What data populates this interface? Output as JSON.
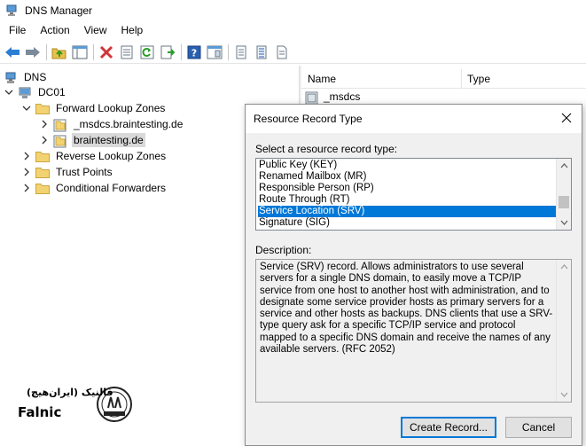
{
  "window": {
    "title": "DNS Manager"
  },
  "menu": [
    "File",
    "Action",
    "View",
    "Help"
  ],
  "toolbar_icons": [
    "back-arrow-icon",
    "forward-arrow-icon",
    "folder-up-icon",
    "show-hide-tree-icon",
    "delete-icon",
    "properties-icon",
    "refresh-icon",
    "export-list-icon",
    "help-icon",
    "console-icon",
    "list-icon",
    "detail-list-icon",
    "document-icon"
  ],
  "tree": {
    "root": "DNS",
    "server": "DC01",
    "forward": "Forward Lookup Zones",
    "zone1": "_msdcs.braintesting.de",
    "zone2": "braintesting.de",
    "reverse": "Reverse Lookup Zones",
    "trust": "Trust Points",
    "conditional": "Conditional Forwarders"
  },
  "list": {
    "col_name": "Name",
    "col_type": "Type",
    "row1": "_msdcs"
  },
  "dialog": {
    "title": "Resource Record Type",
    "select_label": "Select a resource record type:",
    "items": [
      "Public Key (KEY)",
      "Renamed Mailbox (MR)",
      "Responsible Person (RP)",
      "Route Through (RT)",
      "Service Location (SRV)",
      "Signature (SIG)"
    ],
    "selected_index": 4,
    "description_label": "Description:",
    "description": "Service (SRV) record. Allows administrators to use several servers for a single DNS domain, to easily move a TCP/IP service from one host to another host with administration, and to designate some service provider hosts as primary servers for a service and other hosts as backups. DNS clients that use a SRV-type query ask for a specific TCP/IP service and protocol mapped to a specific DNS domain and receive the names of any available servers. (RFC 2052)",
    "create_button": "Create Record...",
    "cancel_button": "Cancel"
  },
  "watermark": {
    "brand_latin": "Falnic",
    "brand_arabic": "فالنیک (ایران‌هیچ)"
  },
  "colors": {
    "selection": "#0078d7",
    "folder": "#e8c04a",
    "delete_red": "#d13438"
  }
}
